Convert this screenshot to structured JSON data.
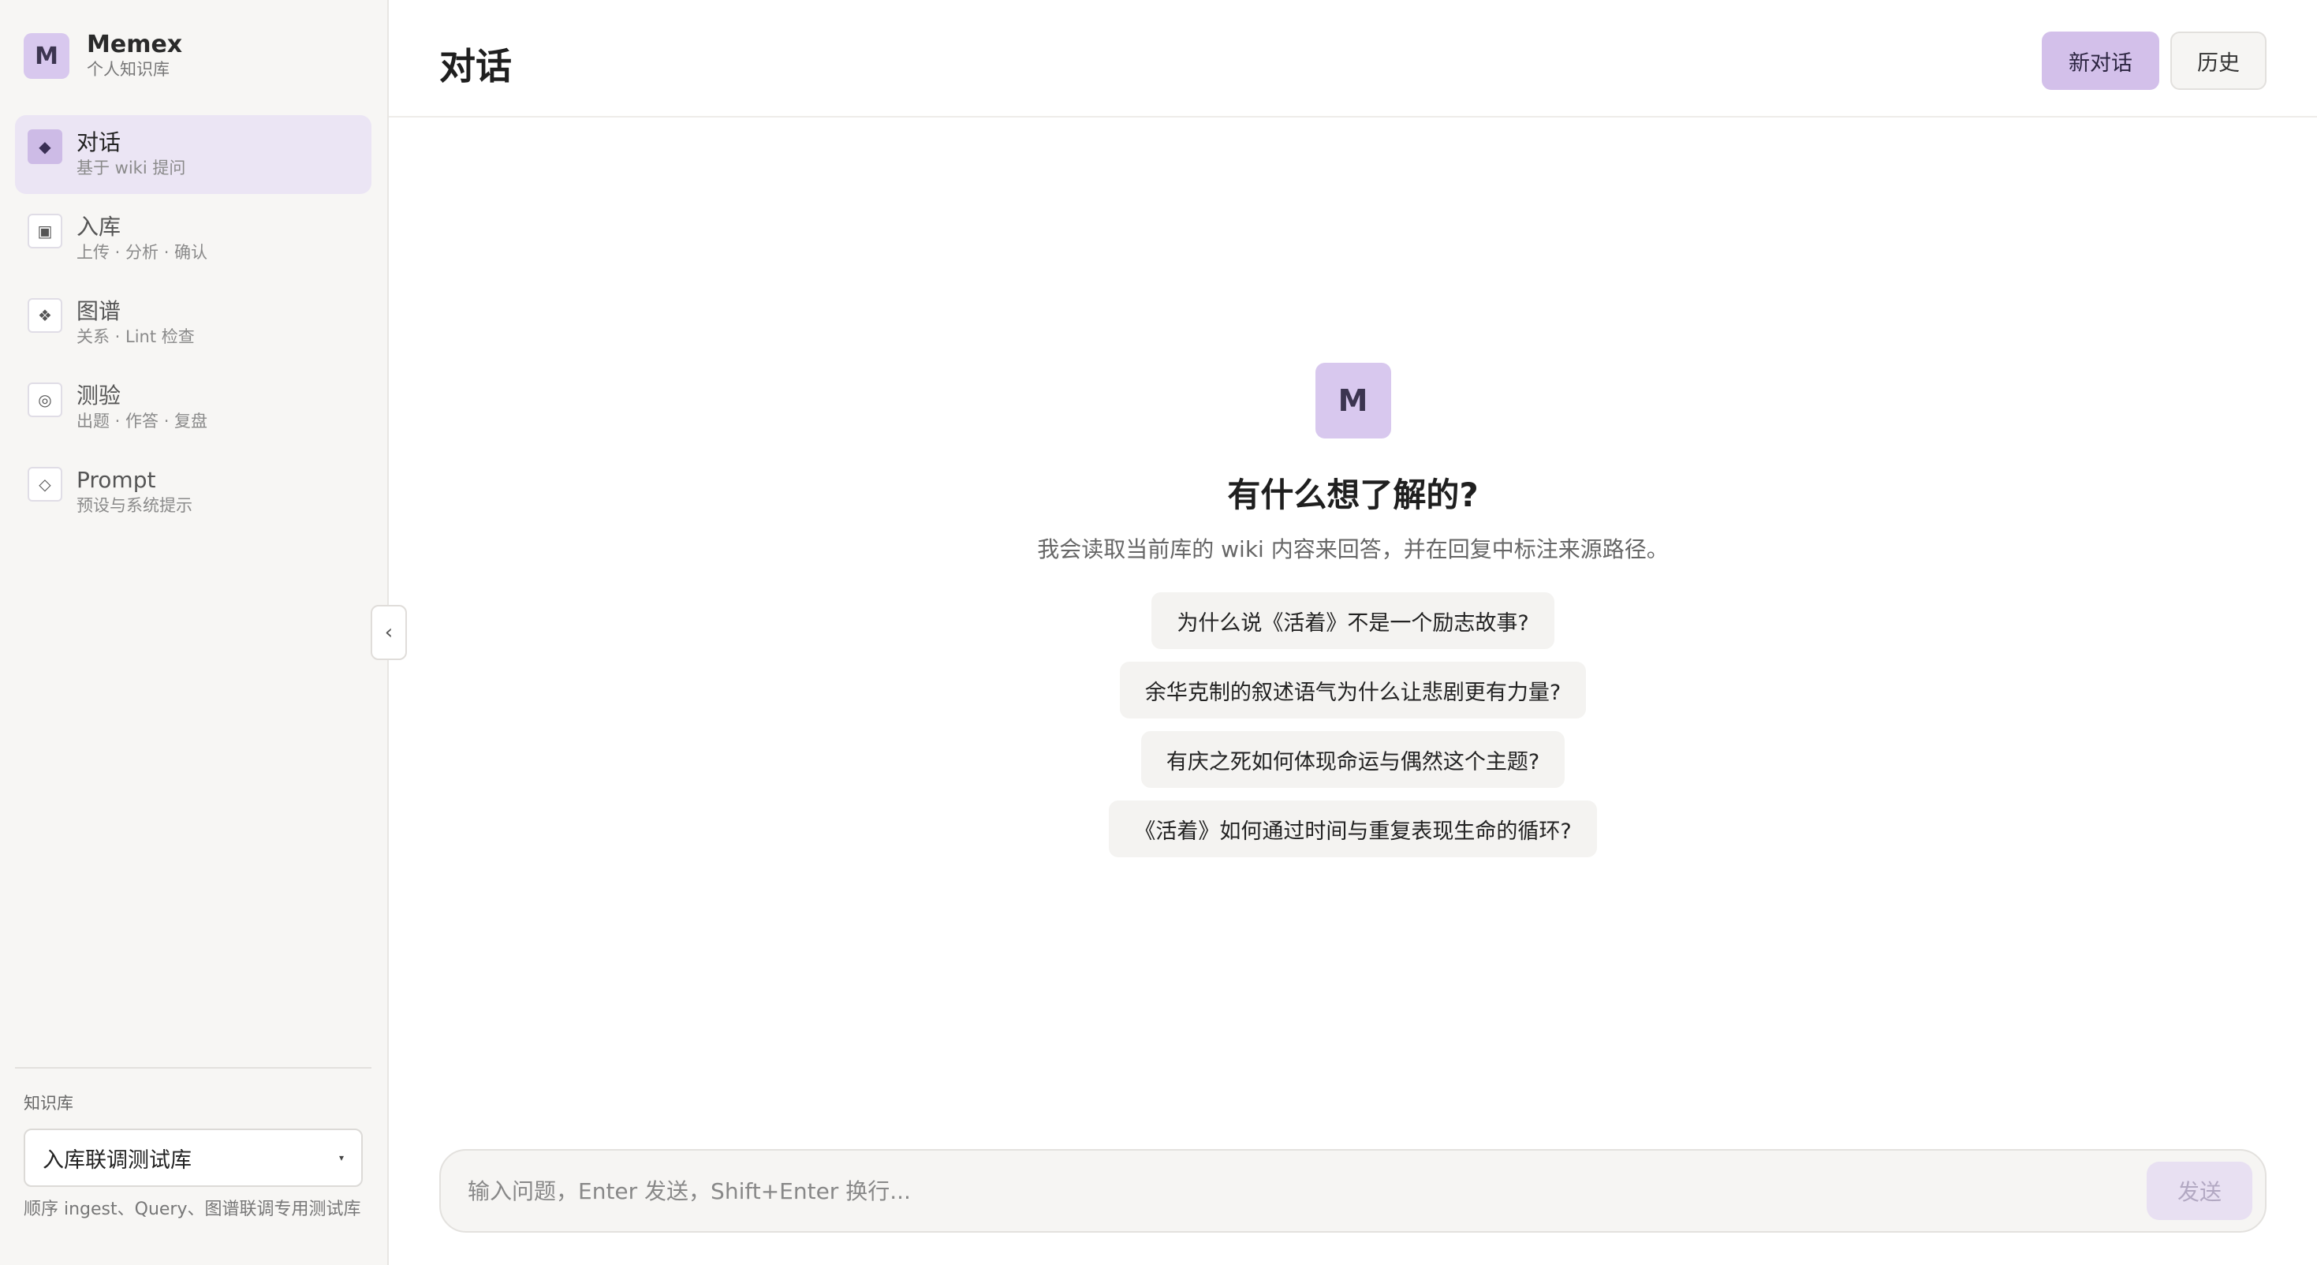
{
  "brand": {
    "initial": "M",
    "name": "Memex",
    "subtitle": "个人知识库"
  },
  "nav": [
    {
      "label": "对话",
      "desc": "基于 wiki 提问",
      "icon": "◆",
      "icon_name": "diamond-filled-icon",
      "active": true
    },
    {
      "label": "入库",
      "desc": "上传 · 分析 · 确认",
      "icon": "▣",
      "icon_name": "square-inbox-icon",
      "active": false
    },
    {
      "label": "图谱",
      "desc": "关系 · Lint 检查",
      "icon": "❖",
      "icon_name": "graph-icon",
      "active": false
    },
    {
      "label": "测验",
      "desc": "出题 · 作答 · 复盘",
      "icon": "◎",
      "icon_name": "target-icon",
      "active": false
    },
    {
      "label": "Prompt",
      "desc": "预设与系统提示",
      "icon": "◇",
      "icon_name": "diamond-outline-icon",
      "active": false
    }
  ],
  "knowledge_base": {
    "title": "知识库",
    "selected": "入库联调测试库",
    "caret": "▾",
    "description": "顺序 ingest、Query、图谱联调专用测试库"
  },
  "collapse_glyph": "‹",
  "header": {
    "title": "对话",
    "new_chat_label": "新对话",
    "history_label": "历史"
  },
  "welcome": {
    "initial": "M",
    "title": "有什么想了解的?",
    "subtitle": "我会读取当前库的 wiki 内容来回答，并在回复中标注来源路径。"
  },
  "suggestions": [
    "为什么说《活着》不是一个励志故事?",
    "余华克制的叙述语气为什么让悲剧更有力量?",
    "有庆之死如何体现命运与偶然这个主题?",
    "《活着》如何通过时间与重复表现生命的循环?"
  ],
  "composer": {
    "placeholder": "输入问题，Enter 发送，Shift+Enter 换行...",
    "send_label": "发送"
  },
  "colors": {
    "accent": "#d3c0ea",
    "active_nav_bg": "#ebe5f4",
    "sidebar_bg": "#f7f6f4"
  }
}
